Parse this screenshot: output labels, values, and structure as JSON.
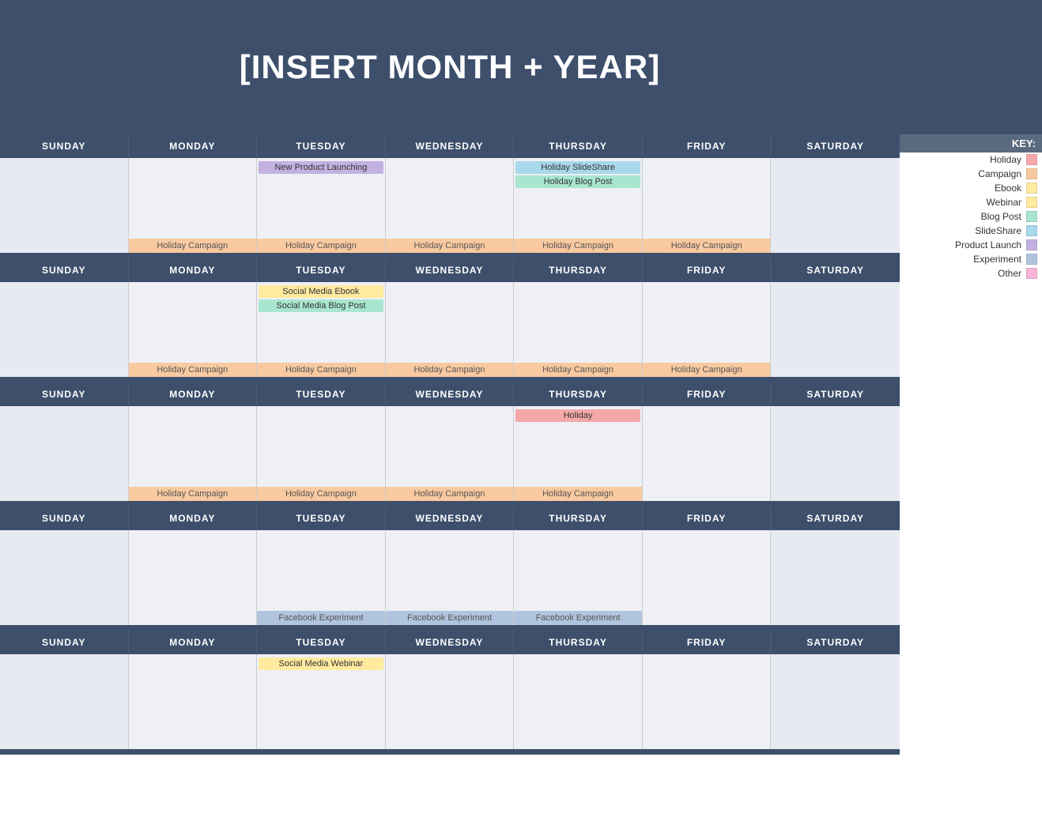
{
  "header": {
    "title": "[INSERT MONTH + YEAR]"
  },
  "key": {
    "label": "KEY:",
    "items": [
      {
        "name": "Holiday",
        "color": "#f4a9a8"
      },
      {
        "name": "Campaign",
        "color": "#f9c9a0"
      },
      {
        "name": "Ebook",
        "color": "#ffeaa0"
      },
      {
        "name": "Webinar",
        "color": "#ffeaa0"
      },
      {
        "name": "Blog Post",
        "color": "#a8e6cf"
      },
      {
        "name": "SlideShare",
        "color": "#a8d8ea"
      },
      {
        "name": "Product Launch",
        "color": "#c3b1e1"
      },
      {
        "name": "Experiment",
        "color": "#b0c4de"
      },
      {
        "name": "Other",
        "color": "#f8b4d9"
      }
    ]
  },
  "days": {
    "headers": [
      "SUNDAY",
      "MONDAY",
      "TUESDAY",
      "WEDNESDAY",
      "THURSDAY",
      "FRIDAY",
      "SATURDAY"
    ]
  },
  "weeks": [
    {
      "cells": [
        {
          "events": [],
          "bottom": ""
        },
        {
          "events": [],
          "bottom": "Holiday Campaign"
        },
        {
          "events": [
            "New Product Launching"
          ],
          "bottom": "Holiday Campaign",
          "eventTypes": [
            "product"
          ]
        },
        {
          "events": [],
          "bottom": "Holiday Campaign"
        },
        {
          "events": [
            "Holiday SlideShare",
            "Holiday Blog Post"
          ],
          "bottom": "Holiday Campaign",
          "eventTypes": [
            "slideshare",
            "blogpost"
          ]
        },
        {
          "events": [],
          "bottom": "Holiday Campaign"
        },
        {
          "events": [],
          "bottom": ""
        }
      ]
    },
    {
      "cells": [
        {
          "events": [],
          "bottom": ""
        },
        {
          "events": [],
          "bottom": "Holiday Campaign"
        },
        {
          "events": [
            "Social Media Ebook",
            "Social Media Blog Post"
          ],
          "bottom": "Holiday Campaign",
          "eventTypes": [
            "ebook",
            "blogpost"
          ]
        },
        {
          "events": [],
          "bottom": "Holiday Campaign"
        },
        {
          "events": [],
          "bottom": "Holiday Campaign"
        },
        {
          "events": [],
          "bottom": "Holiday Campaign"
        },
        {
          "events": [],
          "bottom": ""
        }
      ]
    },
    {
      "cells": [
        {
          "events": [],
          "bottom": ""
        },
        {
          "events": [],
          "bottom": "Holiday Campaign"
        },
        {
          "events": [],
          "bottom": "Holiday Campaign"
        },
        {
          "events": [],
          "bottom": "Holiday Campaign"
        },
        {
          "events": [
            "Holiday"
          ],
          "bottom": "Holiday Campaign",
          "eventTypes": [
            "holiday"
          ]
        },
        {
          "events": [],
          "bottom": ""
        },
        {
          "events": [],
          "bottom": ""
        }
      ]
    },
    {
      "cells": [
        {
          "events": [],
          "bottom": ""
        },
        {
          "events": [],
          "bottom": ""
        },
        {
          "events": [],
          "bottom": "Facebook Experiment",
          "bottomType": "experiment"
        },
        {
          "events": [],
          "bottom": "Facebook Experiment",
          "bottomType": "experiment"
        },
        {
          "events": [],
          "bottom": "Facebook Experiment",
          "bottomType": "experiment"
        },
        {
          "events": [],
          "bottom": ""
        },
        {
          "events": [],
          "bottom": ""
        }
      ]
    },
    {
      "cells": [
        {
          "events": [],
          "bottom": ""
        },
        {
          "events": [],
          "bottom": ""
        },
        {
          "events": [
            "Social Media Webinar"
          ],
          "bottom": "",
          "eventTypes": [
            "webinar"
          ]
        },
        {
          "events": [],
          "bottom": ""
        },
        {
          "events": [],
          "bottom": ""
        },
        {
          "events": [],
          "bottom": ""
        },
        {
          "events": [],
          "bottom": ""
        }
      ]
    }
  ]
}
